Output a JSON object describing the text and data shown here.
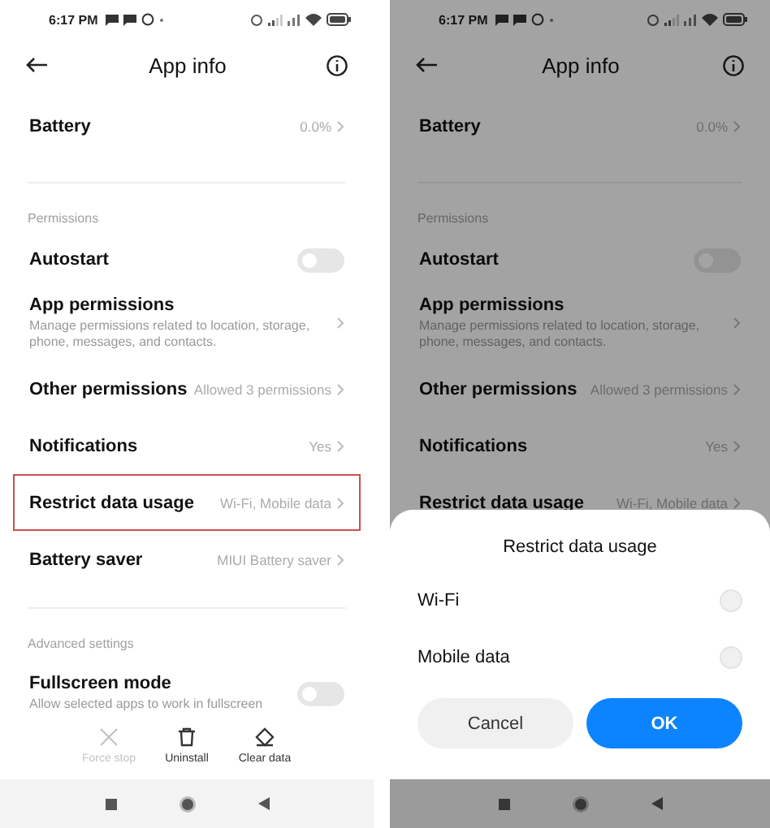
{
  "phones": [
    {
      "dimmed": false,
      "status_bar": {
        "time": "6:17 PM"
      },
      "header": {
        "title": "App info"
      },
      "items": [
        {
          "kind": "link",
          "label": "Battery",
          "value": "0.0%",
          "highlighted": false
        },
        {
          "kind": "section",
          "label": "Permissions"
        },
        {
          "kind": "toggle",
          "label": "Autostart",
          "on": false
        },
        {
          "kind": "link",
          "label": "App permissions",
          "description": "Manage permissions related to location, storage, phone, messages, and contacts.",
          "highlighted": false
        },
        {
          "kind": "link",
          "label": "Other permissions",
          "value": "Allowed 3 permissions",
          "highlighted": false
        },
        {
          "kind": "link",
          "label": "Notifications",
          "value": "Yes",
          "highlighted": false
        },
        {
          "kind": "link",
          "label": "Restrict data usage",
          "value": "Wi-Fi, Mobile data",
          "highlighted": true
        },
        {
          "kind": "link",
          "label": "Battery saver",
          "value": "MIUI Battery saver",
          "highlighted": false
        },
        {
          "kind": "section",
          "label": "Advanced settings"
        },
        {
          "kind": "toggle",
          "label": "Fullscreen mode",
          "description": "Allow selected apps to work in fullscreen",
          "on": false
        }
      ],
      "actions": [
        {
          "kind": "close",
          "label": "Force stop",
          "disabled": true
        },
        {
          "kind": "trash",
          "label": "Uninstall",
          "disabled": false
        },
        {
          "kind": "eraser",
          "label": "Clear data",
          "disabled": false
        }
      ]
    },
    {
      "dimmed": true,
      "status_bar": {
        "time": "6:17 PM"
      },
      "header": {
        "title": "App info"
      },
      "items": [
        {
          "kind": "link",
          "label": "Battery",
          "value": "0.0%",
          "highlighted": false
        },
        {
          "kind": "section",
          "label": "Permissions"
        },
        {
          "kind": "toggle",
          "label": "Autostart",
          "on": false
        },
        {
          "kind": "link",
          "label": "App permissions",
          "description": "Manage permissions related to location, storage, phone, messages, and contacts.",
          "highlighted": false
        },
        {
          "kind": "link",
          "label": "Other permissions",
          "value": "Allowed 3 permissions",
          "highlighted": false
        },
        {
          "kind": "link",
          "label": "Notifications",
          "value": "Yes",
          "highlighted": false
        },
        {
          "kind": "link",
          "label": "Restrict data usage",
          "value": "Wi-Fi, Mobile data",
          "highlighted": false
        }
      ],
      "sheet": {
        "title": "Restrict data usage",
        "options": [
          {
            "label": "Wi-Fi",
            "selected": false
          },
          {
            "label": "Mobile data",
            "selected": false
          }
        ],
        "buttons": [
          {
            "kind": "secondary",
            "label": "Cancel"
          },
          {
            "kind": "primary",
            "label": "OK"
          }
        ]
      }
    }
  ]
}
